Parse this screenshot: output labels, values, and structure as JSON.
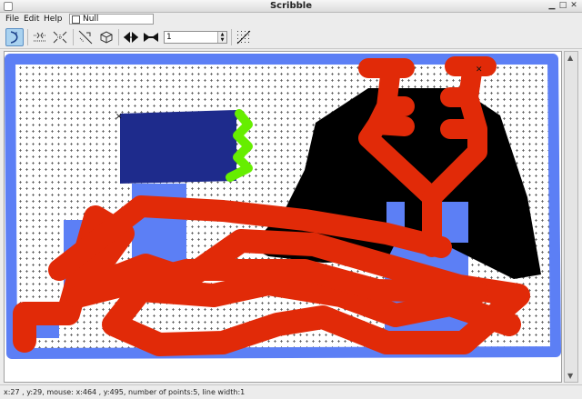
{
  "window": {
    "title": "Scribble"
  },
  "menu": {
    "file": "File",
    "edit": "Edit",
    "help": "Help"
  },
  "null_toggle": {
    "label": "Null",
    "checked": false
  },
  "toolbar": {
    "line_width_value": "1"
  },
  "status": {
    "text": "x:27 , y:29, mouse: x:464 , y:495, number of points:5, line width:1"
  },
  "colors": {
    "stroke_red": "#e12a08",
    "stroke_blue": "#5c7ff5",
    "fill_navy": "#1e2b8c",
    "fill_black": "#000000",
    "stroke_green": "#66ee00",
    "grid_plus": "#333333",
    "canvas_bg": "#ffffff"
  }
}
